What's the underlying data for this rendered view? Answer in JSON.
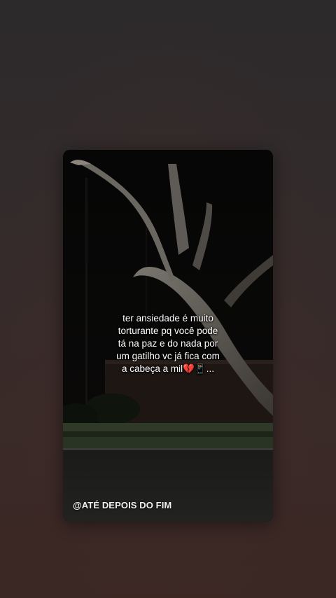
{
  "story": {
    "caption_lines": [
      "ter ansiedade é muito",
      "torturante pq você pode",
      "tá na paz e do nada por",
      "um gatilho vc já fica com",
      "a cabeça a mil💔📱..."
    ],
    "watermark": "@ATÉ DEPOIS DO FIM"
  },
  "colors": {
    "background": "#332b2b",
    "card_background": "#050505",
    "text": "#ffffff"
  }
}
